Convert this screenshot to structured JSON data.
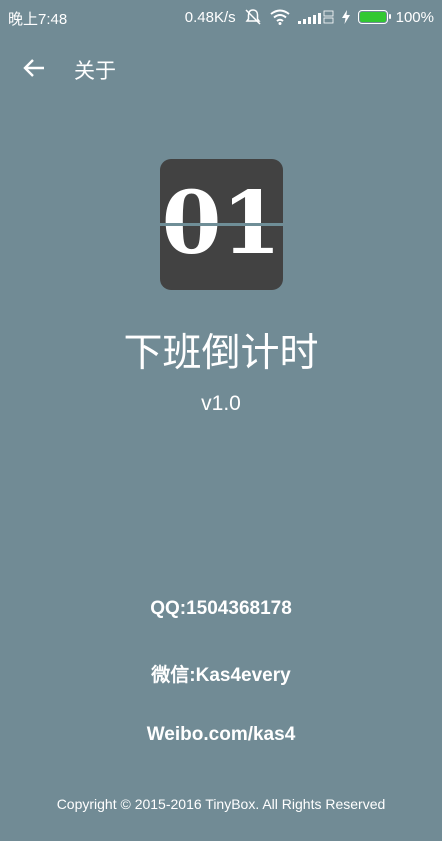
{
  "status_bar": {
    "time": "晚上7:48",
    "net_speed": "0.48K/s",
    "battery": "100%",
    "battery_level": 1.0,
    "battery_color": "#32c832",
    "icons": [
      "mute-icon",
      "wifi-icon",
      "signal-icon",
      "charging-icon",
      "battery-icon"
    ]
  },
  "app_bar": {
    "back_icon": "arrow-left-icon",
    "title": "关于"
  },
  "logo": {
    "text": "01"
  },
  "app_name": "下班倒计时",
  "version": "v1.0",
  "contacts": {
    "qq": "QQ:1504368178",
    "wechat": "微信:Kas4every",
    "weibo": "Weibo.com/kas4"
  },
  "copyright": "Copyright © 2015-2016 TinyBox. All Rights Reserved",
  "colors": {
    "background": "#718b95",
    "logo_bg": "#424242"
  }
}
